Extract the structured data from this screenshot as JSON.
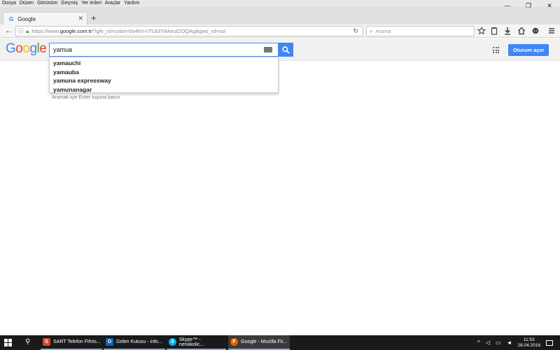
{
  "menu": [
    "Dosya",
    "Düzen",
    "Görünüm",
    "Geçmiş",
    "Yer imleri",
    "Araçlar",
    "Yardım"
  ],
  "window_controls": {
    "minimize": "—",
    "restore": "❐",
    "close": "✕"
  },
  "tab": {
    "favicon": "G",
    "title": "Google",
    "close": "✕"
  },
  "new_tab": "+",
  "nav": {
    "back": "←",
    "url_prefix": "https://www.",
    "url_domain": "google.com.tr",
    "url_rest": "/?gfe_rd=cr&ei=0s4hV-nTL63Y8AeutZOQAg&gws_rd=ssl",
    "reload": "↻",
    "search_placeholder": "Arama",
    "icons": [
      "star-icon",
      "clipboard-icon",
      "download-icon",
      "home-icon",
      "chat-icon",
      "hamburger-menu-icon"
    ]
  },
  "google": {
    "logo_letters": [
      {
        "ch": "G",
        "color": "#4285f4"
      },
      {
        "ch": "o",
        "color": "#ea4335"
      },
      {
        "ch": "o",
        "color": "#fbbc05"
      },
      {
        "ch": "g",
        "color": "#4285f4"
      },
      {
        "ch": "l",
        "color": "#34a853"
      },
      {
        "ch": "e",
        "color": "#ea4335"
      }
    ],
    "query": "yamua",
    "signin_label": "Oturum açın",
    "suggestions": [
      "yamauchi",
      "yamauba",
      "yamuna expressway",
      "yamunanagar"
    ],
    "hint": "Aramak için Enter tuşuna basın",
    "accent": "#4285f4"
  },
  "taskbar": {
    "items": [
      {
        "label": "SART Telefon Fihris...",
        "icon_color": "#d9472b",
        "icon": "S"
      },
      {
        "label": "Gelen Kutusu - info...",
        "icon_color": "#0a64b8",
        "icon": "O"
      },
      {
        "label": "Skype™ - nenakolic...",
        "icon_color": "#00aff0",
        "icon": "S"
      },
      {
        "label": "Google - Mozilla Fir...",
        "icon_color": "#e66000",
        "icon": "F"
      }
    ],
    "time": "11:53",
    "date": "28.04.2016"
  }
}
